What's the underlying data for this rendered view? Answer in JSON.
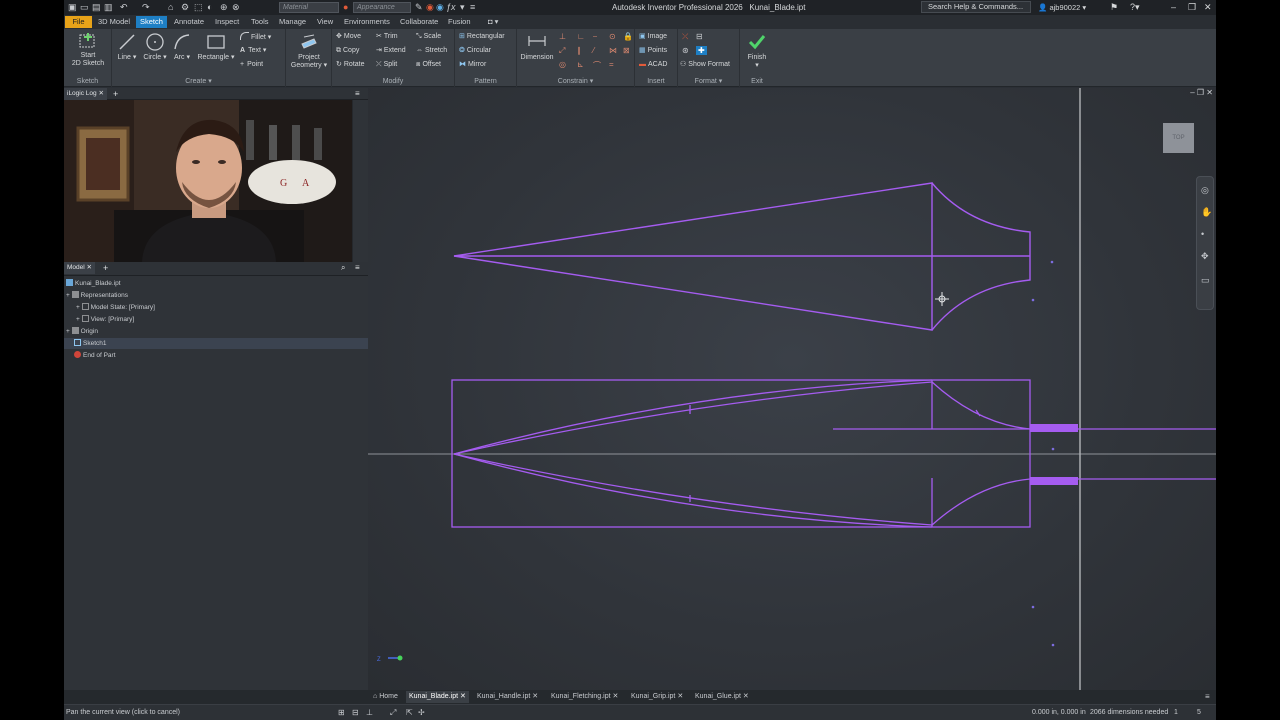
{
  "app": {
    "title": "Autodesk Inventor Professional 2026",
    "document": "Kunai_Blade.ipt",
    "material_placeholder": "Material",
    "appearance_placeholder": "Appearance",
    "search": "Search Help & Commands...",
    "user": "ajb90022"
  },
  "ribbon_tabs": [
    "File",
    "3D Model",
    "Sketch",
    "Annotate",
    "Inspect",
    "Tools",
    "Manage",
    "View",
    "Environments",
    "Collaborate",
    "Fusion"
  ],
  "ribbon": {
    "sketch": {
      "start_line1": "Start",
      "start_line2": "2D Sketch",
      "label": "Sketch"
    },
    "create": {
      "line": "Line",
      "circle": "Circle",
      "arc": "Arc",
      "rectangle": "Rectangle",
      "fillet": "Fillet",
      "text": "Text",
      "point": "Point",
      "label": "Create"
    },
    "project": {
      "line1": "Project",
      "line2": "Geometry"
    },
    "modify": {
      "move": "Move",
      "copy": "Copy",
      "rotate": "Rotate",
      "trim": "Trim",
      "extend": "Extend",
      "split": "Split",
      "scale": "Scale",
      "stretch": "Stretch",
      "offset": "Offset",
      "label": "Modify"
    },
    "pattern": {
      "rectangular": "Rectangular",
      "circular": "Circular",
      "mirror": "Mirror",
      "label": "Pattern"
    },
    "constrain": {
      "dimension": "Dimension",
      "label": "Constrain"
    },
    "insert": {
      "image": "Image",
      "points": "Points",
      "acad": "ACAD",
      "label": "Insert"
    },
    "format": {
      "show_format": "Show Format",
      "label": "Format"
    },
    "exit": {
      "finish": "Finish",
      "label": "Exit"
    }
  },
  "panels": {
    "logic_tab": "iLogic Log",
    "model_tab": "Model"
  },
  "tree": [
    {
      "label": "Kunai_Blade.ipt",
      "indent": 0
    },
    {
      "label": "Representations",
      "indent": 1
    },
    {
      "label": "Model State: [Primary]",
      "indent": 2
    },
    {
      "label": "View: [Primary]",
      "indent": 2
    },
    {
      "label": "Origin",
      "indent": 1
    },
    {
      "label": "Sketch1",
      "indent": 1
    },
    {
      "label": "End of Part",
      "indent": 1
    }
  ],
  "viewcube_label": "TOP",
  "doc_tabs": [
    "Home",
    "Kunai_Blade.ipt",
    "Kunai_Handle.ipt",
    "Kunai_Fletching.ipt",
    "Kunai_Grip.ipt",
    "Kunai_Glue.ipt"
  ],
  "status": {
    "hint": "Pan the current view (click to cancel)",
    "coords": "0.000 in, 0.000 in",
    "dims": "2066 dimensions needed",
    "count1": "1",
    "count2": "5"
  },
  "colors": {
    "sketch": "#a55cf0",
    "accent": "#1e7fc4",
    "file_tab": "#e8a319",
    "canvas": "#33373d"
  }
}
